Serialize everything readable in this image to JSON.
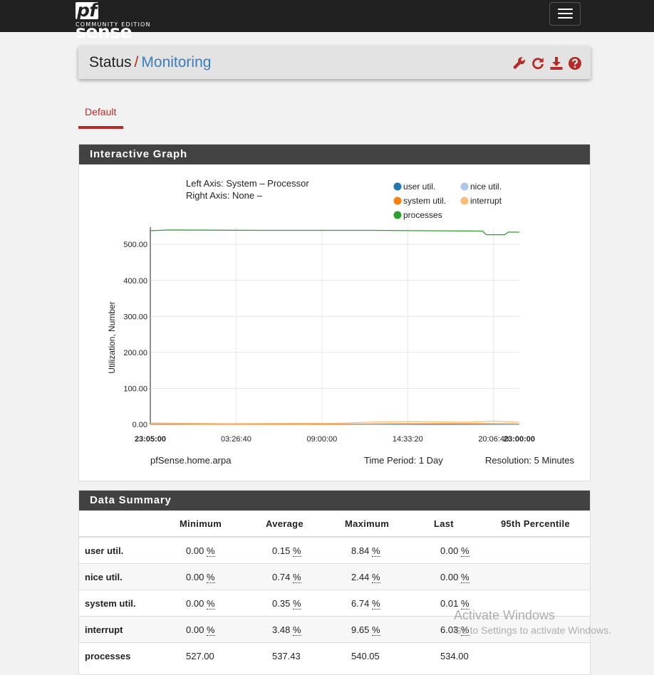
{
  "navbar": {
    "logo_main": "sense",
    "logo_pf": "pf",
    "logo_sub": "COMMUNITY EDITION",
    "menu_icon": "hamburger-icon"
  },
  "header": {
    "crumb_status": "Status",
    "crumb_sep": "/",
    "crumb_monitoring": "Monitoring",
    "icons": [
      "wrench-icon",
      "refresh-icon",
      "download-icon",
      "help-icon"
    ],
    "accent": "#b52b27"
  },
  "tabs": [
    {
      "label": "Default"
    }
  ],
  "graph_panel": {
    "title": "Interactive Graph",
    "left_axis": "Left Axis: System – Processor",
    "right_axis": "Right Axis: None –",
    "ylabel": "Utilization, Number",
    "host": "pfSense.home.arpa",
    "period": "Time Period: 1 Day",
    "resolution": "Resolution: 5 Minutes"
  },
  "chart_data": {
    "type": "line",
    "x_ticks": [
      "23:05:00",
      "03:26:40",
      "09:00:00",
      "14:33:20",
      "20:06:40",
      "23:00:00"
    ],
    "y_ticks": [
      "0.00",
      "100.00",
      "200.00",
      "300.00",
      "400.00",
      "500.00"
    ],
    "ylim": [
      0,
      540
    ],
    "xlabel": "",
    "ylabel": "Utilization, Number",
    "legend_position": "top-right",
    "grid": true,
    "series": [
      {
        "name": "user util.",
        "color": "#1f77b4",
        "x": [
          0,
          0.3,
          0.6,
          0.8,
          1.0
        ],
        "y": [
          0.5,
          0.2,
          0.3,
          0.8,
          0.3
        ]
      },
      {
        "name": "nice util.",
        "color": "#aec7e8",
        "x": [
          0,
          0.3,
          0.6,
          0.8,
          1.0
        ],
        "y": [
          1.0,
          0.6,
          0.8,
          1.5,
          0.8
        ]
      },
      {
        "name": "system util.",
        "color": "#ff7f0e",
        "x": [
          0,
          0.2,
          0.5,
          0.7,
          0.9,
          1.0
        ],
        "y": [
          0.5,
          0.3,
          0.4,
          1.5,
          2.0,
          1.0
        ]
      },
      {
        "name": "interrupt",
        "color": "#ffbb78",
        "x": [
          0,
          0.2,
          0.5,
          0.62,
          0.72,
          0.85,
          0.93,
          1.0
        ],
        "y": [
          4,
          2,
          3,
          7,
          8,
          6,
          9,
          6
        ]
      },
      {
        "name": "processes",
        "color": "#2ca02c",
        "x": [
          0,
          0.05,
          0.3,
          0.6,
          0.9,
          0.91,
          0.96,
          0.97,
          1.0
        ],
        "y": [
          538,
          540,
          539,
          539,
          537,
          527,
          527,
          534,
          534
        ]
      }
    ]
  },
  "summary_panel": {
    "title": "Data Summary",
    "columns": [
      "",
      "Minimum",
      "Average",
      "Maximum",
      "Last",
      "95th Percentile"
    ],
    "rows": [
      {
        "label": "user util.",
        "min": "0.00",
        "avg": "0.15",
        "max": "8.84",
        "last": "0.00",
        "p95": "",
        "unit": "%"
      },
      {
        "label": "nice util.",
        "min": "0.00",
        "avg": "0.74",
        "max": "2.44",
        "last": "0.00",
        "p95": "",
        "unit": "%"
      },
      {
        "label": "system util.",
        "min": "0.00",
        "avg": "0.35",
        "max": "6.74",
        "last": "0.01",
        "p95": "",
        "unit": "%"
      },
      {
        "label": "interrupt",
        "min": "0.00",
        "avg": "3.48",
        "max": "9.65",
        "last": "6.03",
        "p95": "",
        "unit": "%"
      },
      {
        "label": "processes",
        "min": "527.00",
        "avg": "537.43",
        "max": "540.05",
        "last": "534.00",
        "p95": "",
        "unit": ""
      }
    ]
  },
  "watermark": {
    "line1": "Activate Windows",
    "line2": "Go to Settings to activate Windows."
  }
}
